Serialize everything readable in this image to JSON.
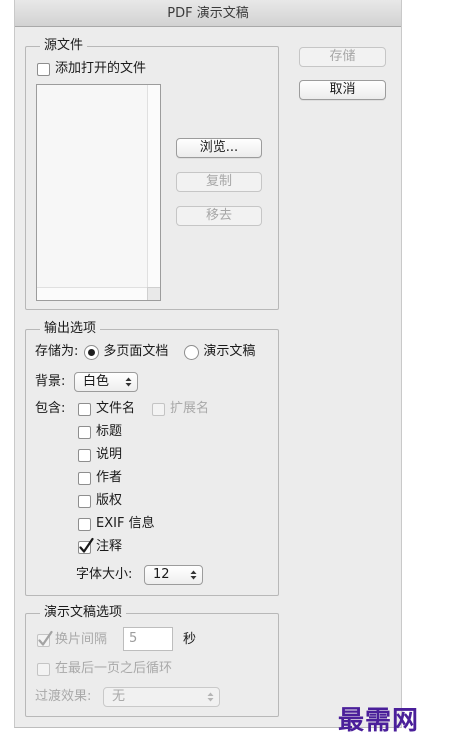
{
  "window": {
    "title": "PDF 演示文稿"
  },
  "actions": {
    "save": "存储",
    "cancel": "取消"
  },
  "source": {
    "title": "源文件",
    "add_open_files": "添加打开的文件",
    "browse": "浏览...",
    "duplicate": "复制",
    "remove": "移去"
  },
  "output": {
    "title": "输出选项",
    "save_as_label": "存储为:",
    "save_as_options": [
      "多页面文档",
      "演示文稿"
    ],
    "save_as_selected": "多页面文档",
    "background_label": "背景:",
    "background_value": "白色",
    "include_label": "包含:",
    "include": {
      "filename": {
        "label": "文件名",
        "checked": false
      },
      "extension": {
        "label": "扩展名",
        "checked": false,
        "enabled": false
      },
      "title": {
        "label": "标题",
        "checked": false
      },
      "description": {
        "label": "说明",
        "checked": false
      },
      "author": {
        "label": "作者",
        "checked": false
      },
      "copyright": {
        "label": "版权",
        "checked": false
      },
      "exif": {
        "label": "EXIF 信息",
        "checked": false
      },
      "notes": {
        "label": "注释",
        "checked": true
      }
    },
    "font_size_label": "字体大小:",
    "font_size_value": "12"
  },
  "presentation": {
    "title": "演示文稿选项",
    "advance_label": "换片间隔",
    "advance_checked": true,
    "advance_enabled": false,
    "advance_value": "5",
    "advance_unit": "秒",
    "loop_label": "在最后一页之后循环",
    "loop_checked": false,
    "transition_label": "过渡效果:",
    "transition_value": "无"
  },
  "watermark": "最需网",
  "colors": {
    "watermark": "#4a1f9a",
    "dialog_bg": "#ececec"
  }
}
